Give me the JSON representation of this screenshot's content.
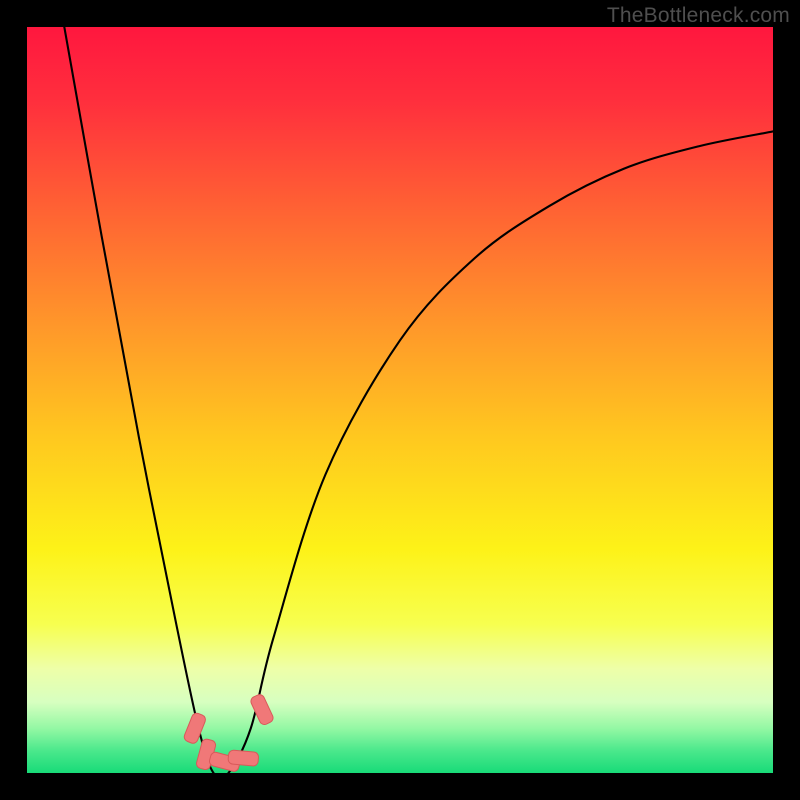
{
  "attribution": "TheBottleneck.com",
  "chart_data": {
    "type": "line",
    "title": "",
    "xlabel": "",
    "ylabel": "",
    "xlim": [
      0,
      100
    ],
    "ylim": [
      0,
      100
    ],
    "series": [
      {
        "name": "curve",
        "x": [
          5,
          10,
          15,
          20,
          23,
          25,
          27,
          30,
          33,
          40,
          50,
          60,
          70,
          80,
          90,
          100
        ],
        "values": [
          100,
          72,
          45,
          20,
          6,
          0,
          0,
          6,
          18,
          40,
          58,
          69,
          76,
          81,
          84,
          86
        ]
      }
    ],
    "markers": [
      {
        "x": 22.5,
        "y": 6.0
      },
      {
        "x": 24.0,
        "y": 2.5
      },
      {
        "x": 26.5,
        "y": 1.5
      },
      {
        "x": 29.0,
        "y": 2.0
      },
      {
        "x": 31.5,
        "y": 8.5
      }
    ],
    "gradient_stops": [
      {
        "offset": 0.0,
        "color": "#ff173e"
      },
      {
        "offset": 0.1,
        "color": "#ff2f3d"
      },
      {
        "offset": 0.25,
        "color": "#ff6433"
      },
      {
        "offset": 0.4,
        "color": "#ff972a"
      },
      {
        "offset": 0.55,
        "color": "#ffc81f"
      },
      {
        "offset": 0.7,
        "color": "#fdf218"
      },
      {
        "offset": 0.8,
        "color": "#f7ff4f"
      },
      {
        "offset": 0.86,
        "color": "#eeffa8"
      },
      {
        "offset": 0.905,
        "color": "#d7ffc0"
      },
      {
        "offset": 0.94,
        "color": "#94f8a4"
      },
      {
        "offset": 0.97,
        "color": "#4be88c"
      },
      {
        "offset": 1.0,
        "color": "#18db78"
      }
    ],
    "marker_style": {
      "fill": "#f07878",
      "stroke": "#d85a5a",
      "rx": 5,
      "width": 14,
      "height": 30
    },
    "curve_stroke": "#000000",
    "curve_width": 2.1
  }
}
